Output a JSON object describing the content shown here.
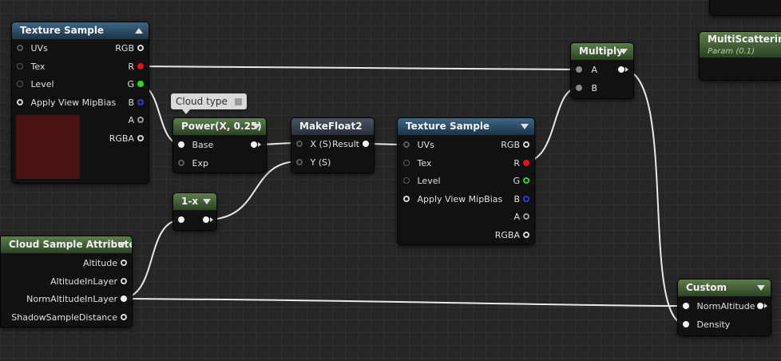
{
  "nodes": {
    "texture_sample_1": {
      "title": "Texture Sample",
      "inputs": [
        "UVs",
        "Tex",
        "Level",
        "Apply View MipBias"
      ],
      "outputs": [
        "RGB",
        "R",
        "G",
        "B",
        "A",
        "RGBA"
      ]
    },
    "multiply": {
      "title": "Multiply",
      "inputs": [
        "A",
        "B"
      ]
    },
    "param": {
      "title": "MultiScatteringEcc",
      "subtitle": "Param (0.1)"
    },
    "comment": {
      "text": "Cloud type"
    },
    "power": {
      "title": "Power(X, 0.25)",
      "inputs": [
        "Base",
        "Exp"
      ]
    },
    "makefloat2": {
      "title": "MakeFloat2",
      "inputs": [
        "X (S)",
        "Y (S)"
      ],
      "output": "Result"
    },
    "texture_sample_2": {
      "title": "Texture Sample",
      "inputs": [
        "UVs",
        "Tex",
        "Level",
        "Apply View MipBias"
      ],
      "outputs": [
        "RGB",
        "R",
        "G",
        "B",
        "A",
        "RGBA"
      ]
    },
    "one_minus_x": {
      "title": "1-x"
    },
    "cloud_sample_attributes": {
      "title": "Cloud Sample Attributes",
      "outputs": [
        "Altitude",
        "AltitudeInLayer",
        "NormAltitudeInLayer",
        "ShadowSampleDistance"
      ]
    },
    "custom": {
      "title": "Custom",
      "inputs": [
        "NormAltitude",
        "Density"
      ]
    }
  },
  "colors": {
    "background": "#262626",
    "texture_header": "#3e6783",
    "math_header": "#5d7e4c",
    "swatch": "#4a1212",
    "pin_red": "#e11414",
    "pin_green": "#22dd22",
    "pin_blue": "#1c2fb8"
  }
}
